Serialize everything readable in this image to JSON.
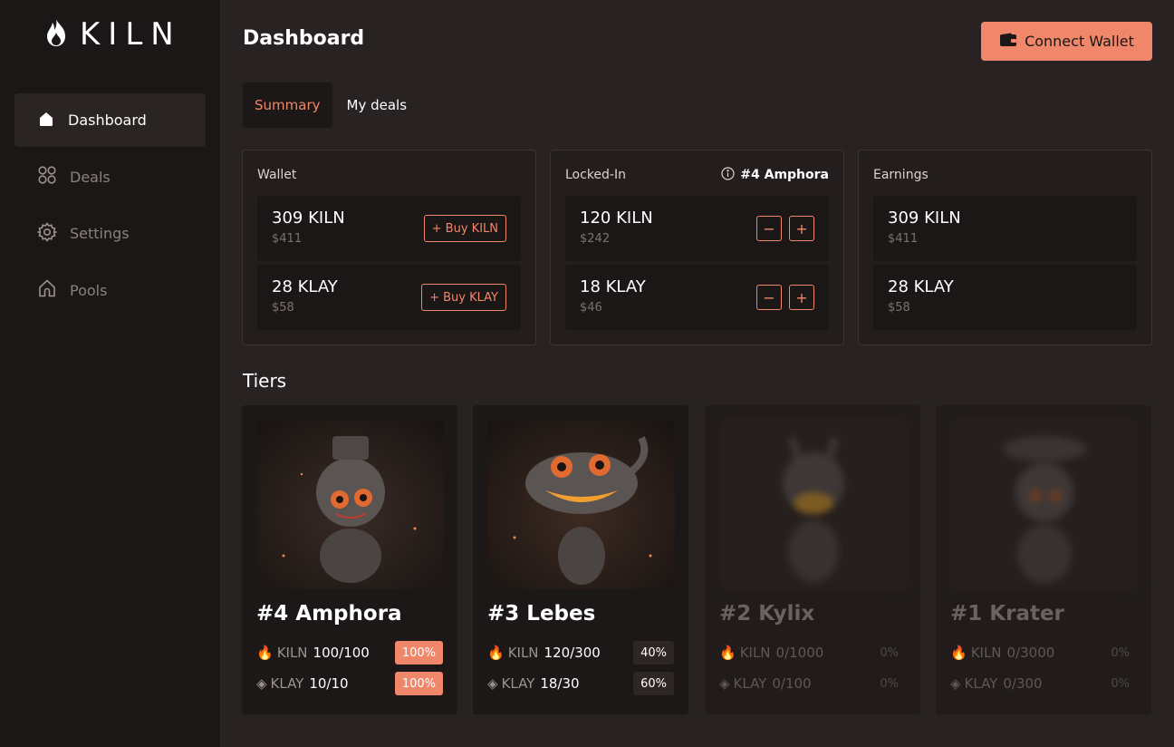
{
  "app": {
    "logo_text": "KILN"
  },
  "sidebar": {
    "items": [
      {
        "label": "Dashboard",
        "icon": "home-icon",
        "active": true
      },
      {
        "label": "Deals",
        "icon": "grid-icon",
        "active": false
      },
      {
        "label": "Settings",
        "icon": "gear-icon",
        "active": false
      },
      {
        "label": "Pools",
        "icon": "pool-icon",
        "active": false
      }
    ]
  },
  "header": {
    "title": "Dashboard",
    "connect_label": "Connect Wallet"
  },
  "tabs": [
    {
      "label": "Summary",
      "active": true
    },
    {
      "label": "My deals",
      "active": false
    }
  ],
  "panels": {
    "wallet": {
      "title": "Wallet",
      "rows": [
        {
          "amount": "309 KILN",
          "usd": "$411",
          "button": "+ Buy KILN"
        },
        {
          "amount": "28 KLAY",
          "usd": "$58",
          "button": "+ Buy KLAY"
        }
      ]
    },
    "locked": {
      "title": "Locked-In",
      "tier_ref": "#4 Amphora",
      "rows": [
        {
          "amount": "120 KILN",
          "usd": "$242",
          "minus": "−",
          "plus": "+"
        },
        {
          "amount": "18 KLAY",
          "usd": "$46",
          "minus": "−",
          "plus": "+"
        }
      ]
    },
    "earnings": {
      "title": "Earnings",
      "rows": [
        {
          "amount": "309 KILN",
          "usd": "$411"
        },
        {
          "amount": "28 KLAY",
          "usd": "$58"
        }
      ]
    }
  },
  "tiers": {
    "title": "Tiers",
    "cards": [
      {
        "name": "#4 Amphora",
        "locked": false,
        "kiln_label": "KILN",
        "kiln_value": "100/100",
        "kiln_pct": "100%",
        "klay_label": "KLAY",
        "klay_value": "10/10",
        "klay_pct": "100%"
      },
      {
        "name": "#3 Lebes",
        "locked": false,
        "kiln_label": "KILN",
        "kiln_value": "120/300",
        "kiln_pct": "40%",
        "klay_label": "KLAY",
        "klay_value": "18/30",
        "klay_pct": "60%"
      },
      {
        "name": "#2 Kylix",
        "locked": true,
        "kiln_label": "KILN",
        "kiln_value": "0/1000",
        "kiln_pct": "0%",
        "klay_label": "KLAY",
        "klay_value": "0/100",
        "klay_pct": "0%"
      },
      {
        "name": "#1 Krater",
        "locked": true,
        "kiln_label": "KILN",
        "kiln_value": "0/3000",
        "kiln_pct": "0%",
        "klay_label": "KLAY",
        "klay_value": "0/300",
        "klay_pct": "0%"
      }
    ]
  },
  "colors": {
    "accent": "#f0876a",
    "sidebar_bg": "#1b1716",
    "page_bg": "#282322"
  }
}
